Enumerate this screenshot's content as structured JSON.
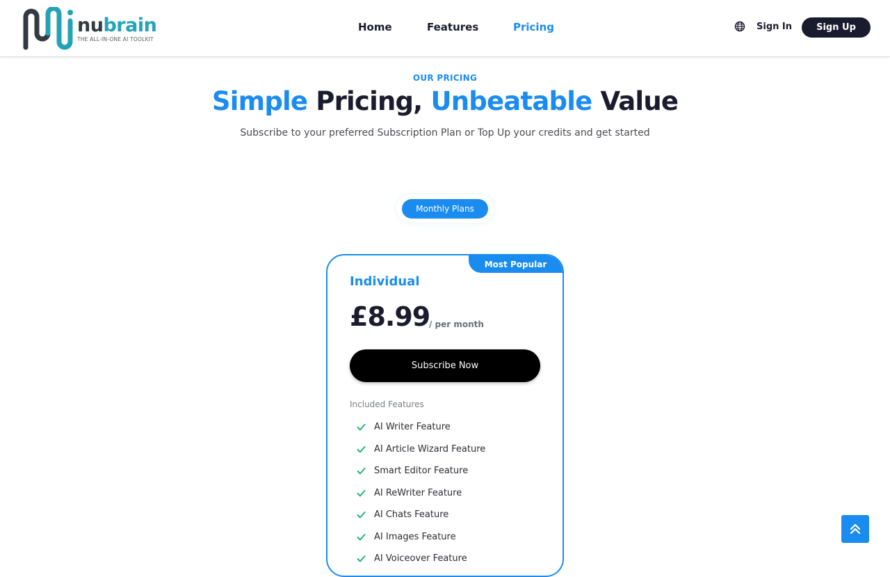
{
  "brand": {
    "name_part1": "nu",
    "name_part2": "brain",
    "tagline": "THE ALL-IN-ONE AI TOOLKIT",
    "colors": {
      "dark": "#333a42",
      "teal": "#24a3b8"
    }
  },
  "nav": {
    "items": [
      {
        "label": "Home",
        "active": false
      },
      {
        "label": "Features",
        "active": false
      },
      {
        "label": "Pricing",
        "active": true
      }
    ],
    "language_icon": "globe-icon",
    "signin_label": "Sign In",
    "signup_label": "Sign Up"
  },
  "hero": {
    "eyebrow": "OUR PRICING",
    "title_w1": "Simple",
    "title_w2": " Pricing, ",
    "title_w3": "Unbeatable",
    "title_w4": " Value",
    "subtitle": "Subscribe to your preferred Subscription Plan or Top Up your credits and get started"
  },
  "toggle": {
    "label": "Monthly Plans"
  },
  "plan": {
    "badge": "Most Popular",
    "name": "Individual",
    "price": "£8.99",
    "period": "/  per month",
    "cta": "Subscribe Now",
    "features_label": "Included Features",
    "features": [
      "AI Writer Feature",
      "AI Article Wizard Feature",
      "Smart Editor Feature",
      "AI ReWriter Feature",
      "AI Chats Feature",
      "AI Images Feature",
      "AI Voiceover Feature"
    ]
  },
  "colors": {
    "accent": "#1a8cf0",
    "dark": "#1b1b2f",
    "check": "#22b573"
  },
  "back_to_top_icon": "chevron-double-up-icon"
}
